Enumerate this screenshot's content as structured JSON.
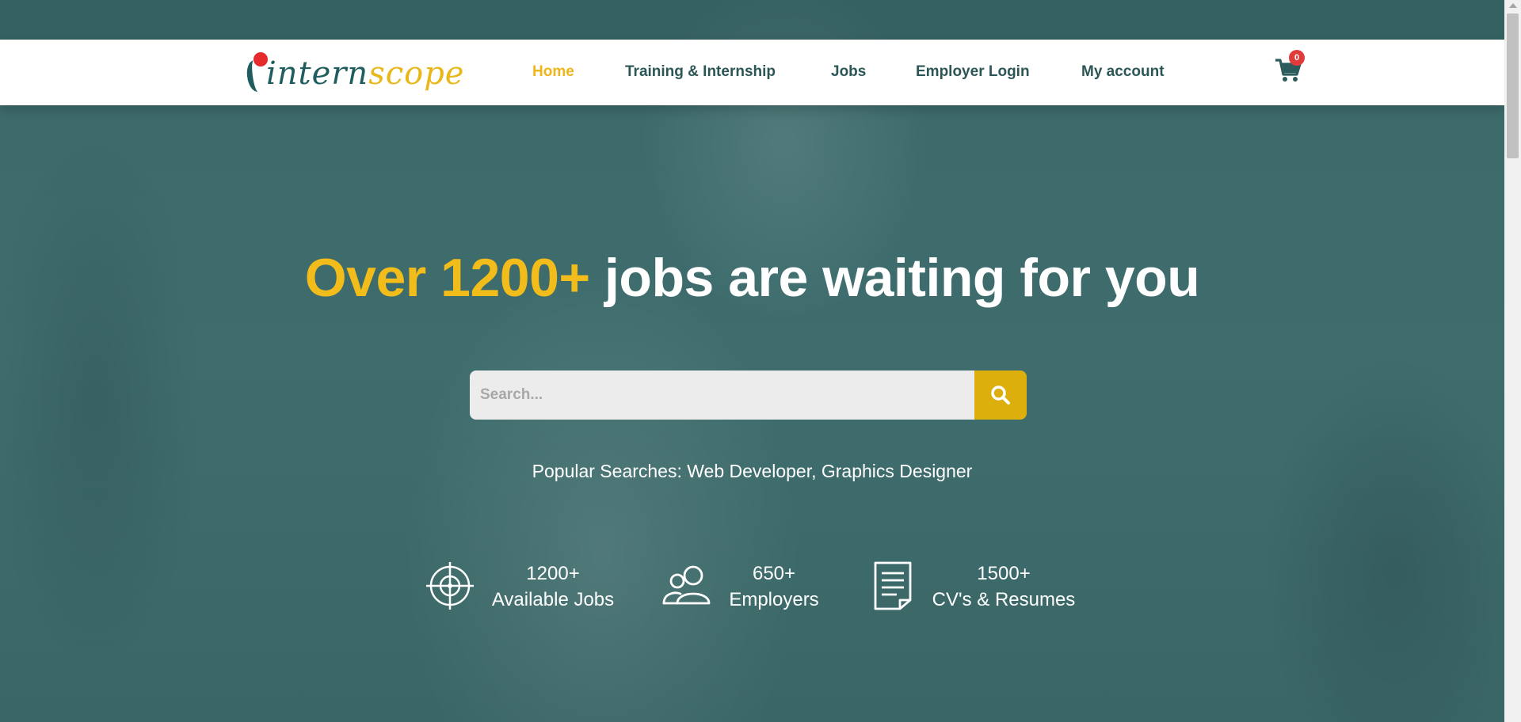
{
  "brand": {
    "logo_part1": "intern",
    "logo_part2": "scope"
  },
  "nav": {
    "items": [
      {
        "label": "Home",
        "active": true
      },
      {
        "label": "Training & Internship",
        "active": false
      },
      {
        "label": "Jobs",
        "active": false
      },
      {
        "label": "Employer Login",
        "active": false
      },
      {
        "label": "My account",
        "active": false
      }
    ],
    "cart_count": "0",
    "cart_icon": "cart-icon"
  },
  "hero": {
    "headline_highlight": "Over 1200+",
    "headline_rest": "jobs are waiting for you",
    "search_placeholder": "Search...",
    "search_value": "",
    "search_icon": "search-icon",
    "popular_searches": "Popular Searches: Web Developer, Graphics Designer"
  },
  "stats": [
    {
      "value": "1200+",
      "label": "Available Jobs",
      "icon": "target-icon"
    },
    {
      "value": "650+",
      "label": "Employers",
      "icon": "users-icon"
    },
    {
      "value": "1500+",
      "label": "CV's & Resumes",
      "icon": "document-icon"
    }
  ],
  "colors": {
    "accent": "#f2bc1a",
    "brand_dark": "#1f5d5e",
    "search_button": "#dcaf0c",
    "badge": "#e03b3b"
  }
}
